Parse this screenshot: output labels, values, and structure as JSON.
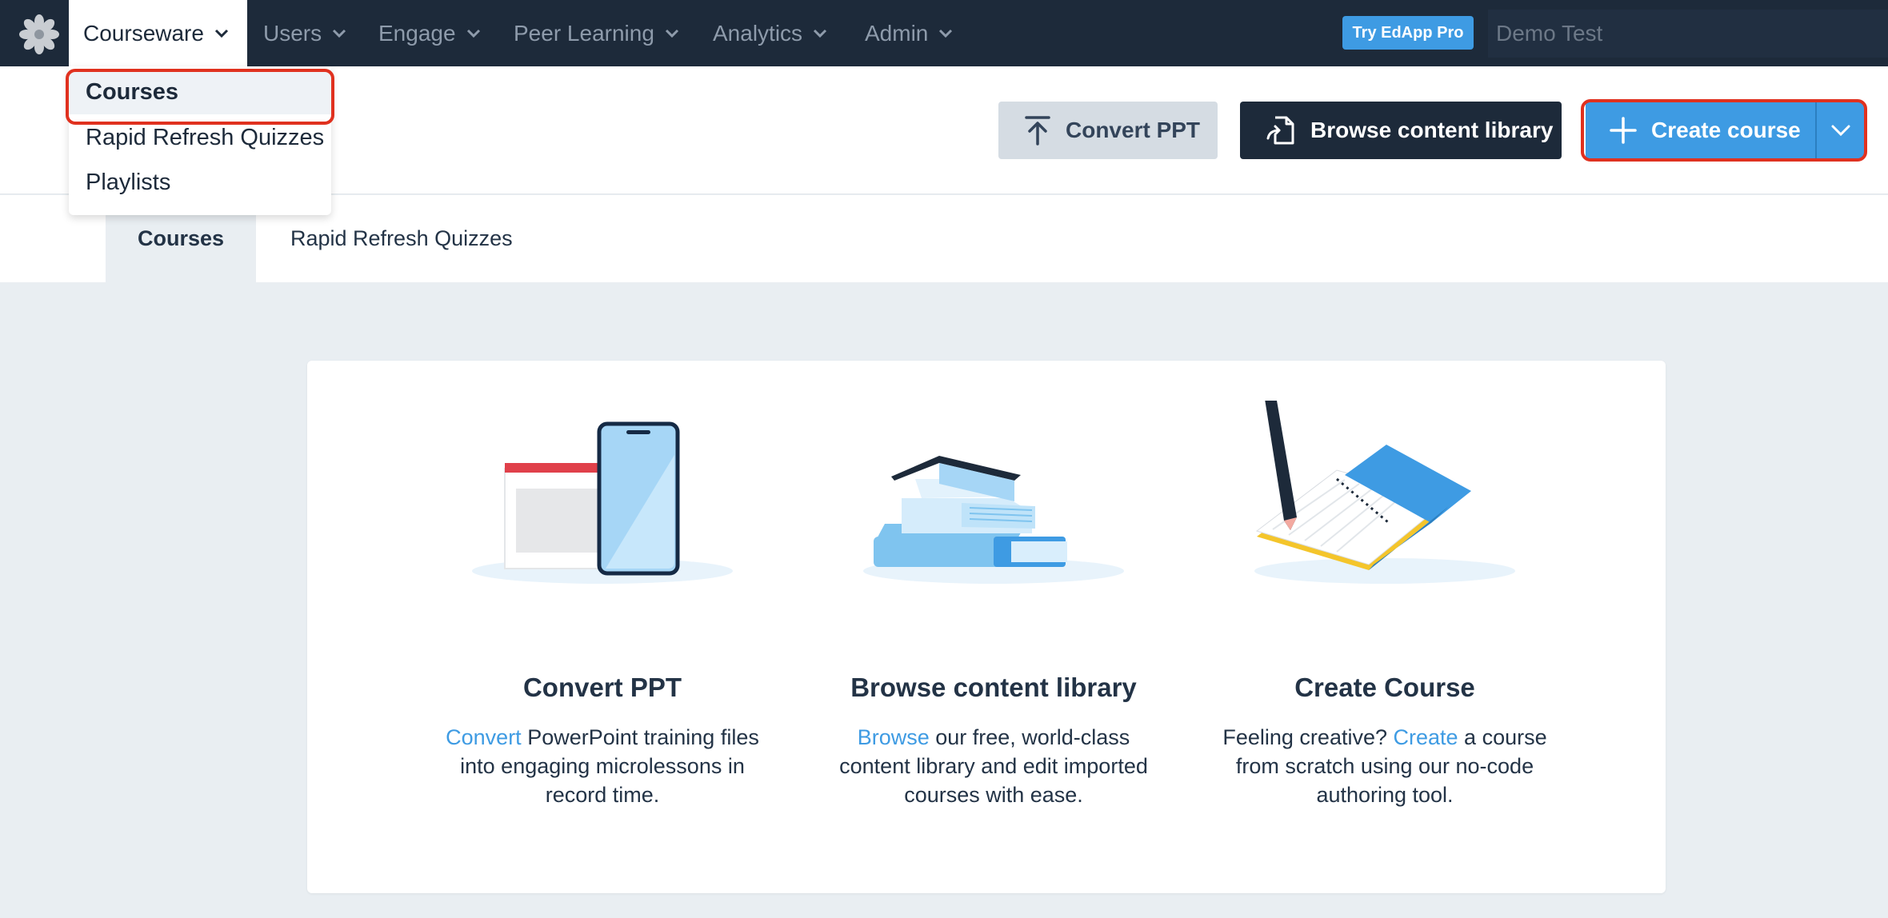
{
  "nav": {
    "logo_icon": "gear-flower-icon",
    "items": [
      {
        "label": "Courseware"
      },
      {
        "label": "Users"
      },
      {
        "label": "Engage"
      },
      {
        "label": "Peer Learning"
      },
      {
        "label": "Analytics"
      },
      {
        "label": "Admin"
      }
    ],
    "pro_button": "Try EdApp Pro",
    "account": "Demo Test"
  },
  "dropdown": {
    "items": [
      {
        "label": "Courses"
      },
      {
        "label": "Rapid Refresh Quizzes"
      },
      {
        "label": "Playlists"
      }
    ]
  },
  "toolbar": {
    "convert_label": "Convert PPT",
    "browse_label": "Browse content library",
    "create_label": "Create course"
  },
  "tabs": [
    {
      "label": "Courses"
    },
    {
      "label": "Rapid Refresh Quizzes"
    }
  ],
  "cards": [
    {
      "title": "Convert PPT",
      "link": "Convert",
      "pre": "",
      "post": " PowerPoint training files into engaging microlessons in record time."
    },
    {
      "title": "Browse content library",
      "link": "Browse",
      "pre": "",
      "post": " our free, world-class content library and edit imported courses with ease."
    },
    {
      "title": "Create Course",
      "link": "Create",
      "pre": "Feeling creative? ",
      "post": " a course from scratch using our no-code authoring tool."
    }
  ],
  "colors": {
    "accent": "#3e9be3",
    "nav_bg": "#1d2a3a",
    "highlight": "#e0311f"
  }
}
